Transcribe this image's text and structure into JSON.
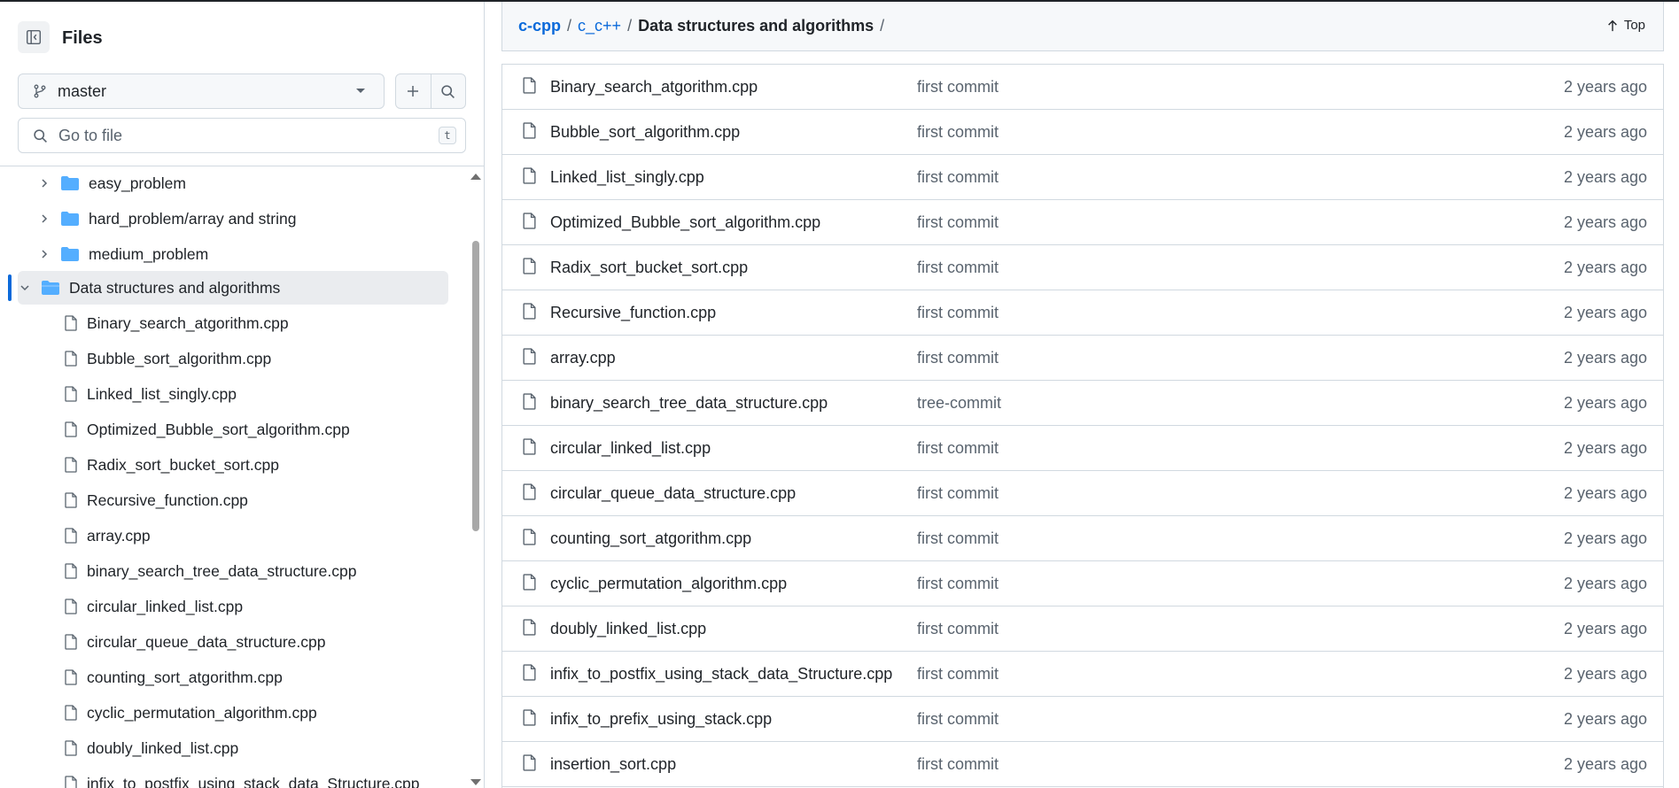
{
  "sidebar": {
    "title": "Files",
    "collapse_icon": "sidebar-collapse-icon",
    "branch": {
      "name": "master",
      "icon": "git-branch-icon"
    },
    "add_icon": "plus-icon",
    "search_icon": "search-icon",
    "goto": {
      "placeholder": "Go to file",
      "shortcut": "t"
    },
    "folders": [
      {
        "label": "easy_problem"
      },
      {
        "label": "hard_problem/array and string"
      },
      {
        "label": "medium_problem"
      }
    ],
    "open_folder": {
      "label": "Data structures and algorithms"
    },
    "files": [
      {
        "label": "Binary_search_atgorithm.cpp"
      },
      {
        "label": "Bubble_sort_algorithm.cpp"
      },
      {
        "label": "Linked_list_singly.cpp"
      },
      {
        "label": "Optimized_Bubble_sort_algorithm.cpp"
      },
      {
        "label": "Radix_sort_bucket_sort.cpp"
      },
      {
        "label": "Recursive_function.cpp"
      },
      {
        "label": "array.cpp"
      },
      {
        "label": "binary_search_tree_data_structure.cpp"
      },
      {
        "label": "circular_linked_list.cpp"
      },
      {
        "label": "circular_queue_data_structure.cpp"
      },
      {
        "label": "counting_sort_atgorithm.cpp"
      },
      {
        "label": "cyclic_permutation_algorithm.cpp"
      },
      {
        "label": "doubly_linked_list.cpp"
      },
      {
        "label": "infix_to_postfix_using_stack_data_Structure.cpp"
      }
    ]
  },
  "breadcrumb": {
    "repo": "c-cpp",
    "sep1": "/",
    "dir": "c_c++",
    "sep2": "/",
    "current": "Data structures and algorithms",
    "sep3": "/"
  },
  "top_link": {
    "label": "Top",
    "icon": "arrow-up-icon"
  },
  "files": [
    {
      "name": "Binary_search_atgorithm.cpp",
      "commit": "first commit",
      "date": "2 years ago"
    },
    {
      "name": "Bubble_sort_algorithm.cpp",
      "commit": "first commit",
      "date": "2 years ago"
    },
    {
      "name": "Linked_list_singly.cpp",
      "commit": "first commit",
      "date": "2 years ago"
    },
    {
      "name": "Optimized_Bubble_sort_algorithm.cpp",
      "commit": "first commit",
      "date": "2 years ago"
    },
    {
      "name": "Radix_sort_bucket_sort.cpp",
      "commit": "first commit",
      "date": "2 years ago"
    },
    {
      "name": "Recursive_function.cpp",
      "commit": "first commit",
      "date": "2 years ago"
    },
    {
      "name": "array.cpp",
      "commit": "first commit",
      "date": "2 years ago"
    },
    {
      "name": "binary_search_tree_data_structure.cpp",
      "commit": "tree-commit",
      "date": "2 years ago"
    },
    {
      "name": "circular_linked_list.cpp",
      "commit": "first commit",
      "date": "2 years ago"
    },
    {
      "name": "circular_queue_data_structure.cpp",
      "commit": "first commit",
      "date": "2 years ago"
    },
    {
      "name": "counting_sort_atgorithm.cpp",
      "commit": "first commit",
      "date": "2 years ago"
    },
    {
      "name": "cyclic_permutation_algorithm.cpp",
      "commit": "first commit",
      "date": "2 years ago"
    },
    {
      "name": "doubly_linked_list.cpp",
      "commit": "first commit",
      "date": "2 years ago"
    },
    {
      "name": "infix_to_postfix_using_stack_data_Structure.cpp",
      "commit": "first commit",
      "date": "2 years ago"
    },
    {
      "name": "infix_to_prefix_using_stack.cpp",
      "commit": "first commit",
      "date": "2 years ago"
    },
    {
      "name": "insertion_sort.cpp",
      "commit": "first commit",
      "date": "2 years ago"
    }
  ],
  "colors": {
    "accent": "#0969da",
    "folder": "#54aeff",
    "muted": "#59636e",
    "border": "#d1d9e0"
  }
}
